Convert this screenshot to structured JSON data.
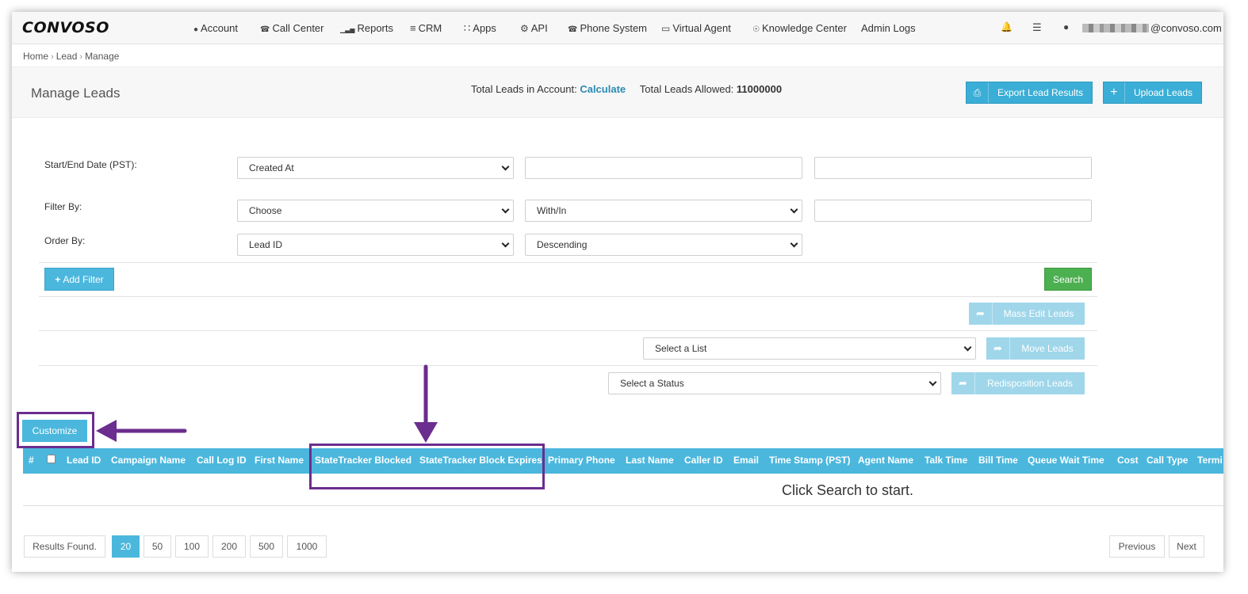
{
  "nav": {
    "logo": "CONVOSO",
    "items": [
      {
        "icon": "user-icon",
        "glyph": "●",
        "label": "Account"
      },
      {
        "icon": "phone-icon",
        "glyph": "☎",
        "label": "Call Center"
      },
      {
        "icon": "bar-chart-icon",
        "glyph": "▁▃▅",
        "label": "Reports"
      },
      {
        "icon": "list-icon",
        "glyph": "≡",
        "label": "CRM"
      },
      {
        "icon": "grid-icon",
        "glyph": "∷",
        "label": "Apps"
      },
      {
        "icon": "gear-icon",
        "glyph": "⚙",
        "label": "API"
      },
      {
        "icon": "phone-icon",
        "glyph": "☎",
        "label": "Phone System"
      },
      {
        "icon": "desktop-icon",
        "glyph": "▭",
        "label": "Virtual Agent"
      },
      {
        "icon": "lightbulb-icon",
        "glyph": "☉",
        "label": "Knowledge Center"
      },
      {
        "icon": "",
        "glyph": "",
        "label": "Admin Logs"
      }
    ],
    "user_email_suffix": "@convoso.com"
  },
  "breadcrumb": [
    "Home",
    "Lead",
    "Manage"
  ],
  "header": {
    "title": "Manage Leads",
    "total_label": "Total Leads in Account:",
    "calculate": "Calculate",
    "allowed_label": "Total Leads Allowed:",
    "allowed_value": "11000000",
    "export_label": "Export Lead Results",
    "upload_label": "Upload Leads"
  },
  "form": {
    "date_label": "Start/End Date (PST):",
    "date_field": "Created At",
    "filter_label": "Filter By:",
    "filter_field": "Choose",
    "filter_op": "With/In",
    "order_label": "Order By:",
    "order_field": "Lead ID",
    "order_dir": "Descending",
    "add_filter": "Add Filter",
    "search": "Search"
  },
  "actions": {
    "mass_edit": "Mass Edit Leads",
    "list_placeholder": "Select a List",
    "move": "Move Leads",
    "status_placeholder": "Select a Status",
    "redisposition": "Redisposition Leads"
  },
  "customize": "Customize",
  "table": {
    "columns": [
      "#",
      "Lead ID",
      "Campaign Name",
      "Call Log ID",
      "First Name",
      "StateTracker Blocked",
      "StateTracker Block Expires",
      "Primary Phone",
      "Last Name",
      "Caller ID",
      "Email",
      "Time Stamp (PST)",
      "Agent Name",
      "Talk Time",
      "Bill Time",
      "Queue Wait Time",
      "Cost",
      "Call Type",
      "Termi"
    ],
    "empty_message": "Click Search to start."
  },
  "pagination": {
    "results_label": "Results Found.",
    "sizes": [
      "20",
      "50",
      "100",
      "200",
      "500",
      "1000"
    ],
    "active_size": "20",
    "previous": "Previous",
    "next": "Next"
  },
  "annotation_color": "#6b2d8e"
}
